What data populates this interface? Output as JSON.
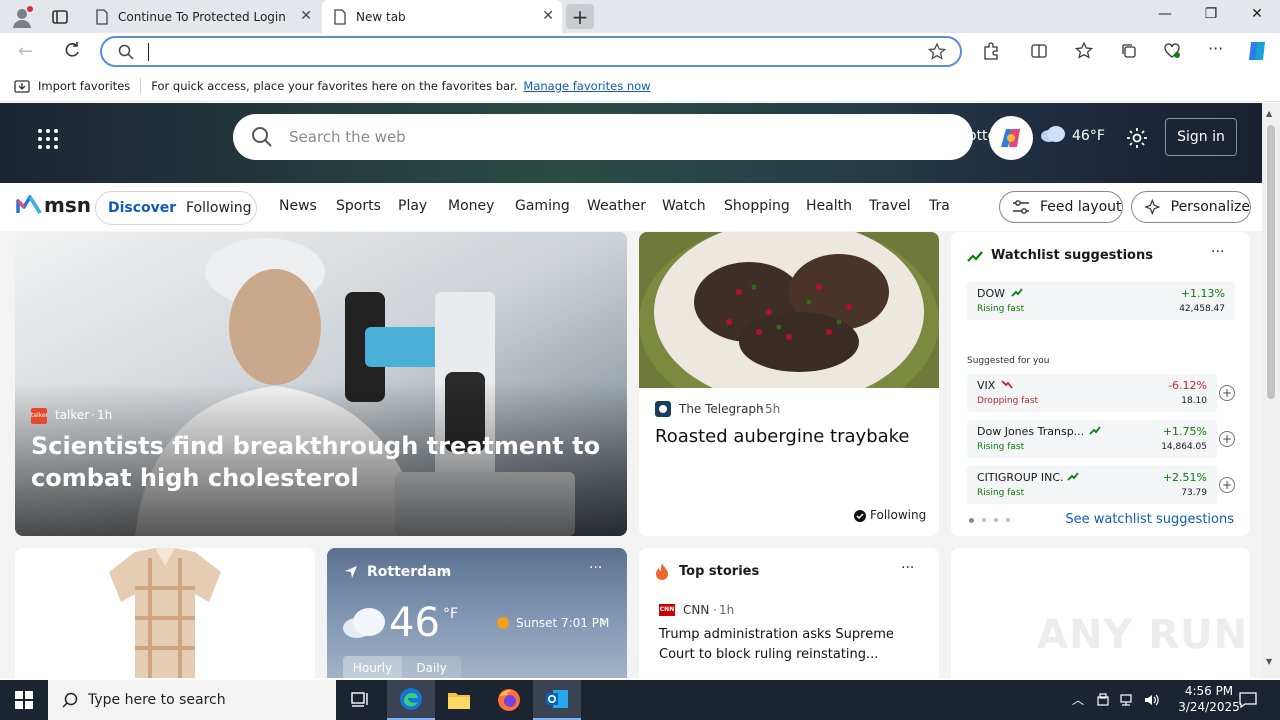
{
  "browser": {
    "tabs": [
      {
        "title": "Continue To Protected Login"
      },
      {
        "title": "New tab"
      }
    ],
    "address_value": "",
    "favbar": {
      "import_label": "Import favorites",
      "message": "For quick access, place your favorites here on the favorites bar.",
      "manage_link": "Manage favorites now"
    }
  },
  "msn": {
    "search_placeholder": "Search the web",
    "weather_temp": "46°F",
    "partial_text": "otterdar",
    "sign_in": "Sign in",
    "logo_text": "msn",
    "primary_tabs": [
      "Discover",
      "Following"
    ],
    "nav": [
      "News",
      "Sports",
      "Play",
      "Money",
      "Gaming",
      "Weather",
      "Watch",
      "Shopping",
      "Health",
      "Travel",
      "Tra"
    ],
    "feed_layout": "Feed layout",
    "personalize": "Personalize"
  },
  "hero": {
    "source_badge": "talker",
    "source": "talker",
    "time": "1h",
    "headline": "Scientists find breakthrough treatment to combat high cholesterol"
  },
  "food": {
    "source": "The Telegraph",
    "time": "5h",
    "headline": "Roasted aubergine traybake",
    "following": "Following"
  },
  "watchlist": {
    "title": "Watchlist suggestions",
    "suggested_label": "Suggested for you",
    "see_link": "See watchlist suggestions",
    "stocks": [
      {
        "name": "DOW",
        "status": "Rising fast",
        "change": "+1.13%",
        "price": "42,458.47",
        "trend": "up"
      },
      {
        "name": "VIX",
        "status": "Dropping fast",
        "change": "-6.12%",
        "price": "18.10",
        "trend": "down"
      },
      {
        "name": "Dow Jones Transp...",
        "status": "Rising fast",
        "change": "+1.75%",
        "price": "14,864.05",
        "trend": "up"
      },
      {
        "name": "CITIGROUP INC.",
        "status": "Rising fast",
        "change": "+2.51%",
        "price": "73.79",
        "trend": "up"
      }
    ],
    "colors": {
      "up": "#0e7a0d",
      "down": "#c4262e"
    }
  },
  "weather": {
    "city": "Rotterdam",
    "temp": "46",
    "unit": "°F",
    "sunset": "Sunset 7:01 PM",
    "tabs": [
      "Hourly",
      "Daily"
    ]
  },
  "top_stories": {
    "title": "Top stories",
    "source_badge": "CNN",
    "source": "CNN",
    "time": "1h",
    "headline": "Trump administration asks Supreme Court to block ruling reinstating..."
  },
  "watermark": "ANY RUN",
  "taskbar": {
    "search_placeholder": "Type here to search",
    "time": "4:56 PM",
    "date": "3/24/2025"
  }
}
